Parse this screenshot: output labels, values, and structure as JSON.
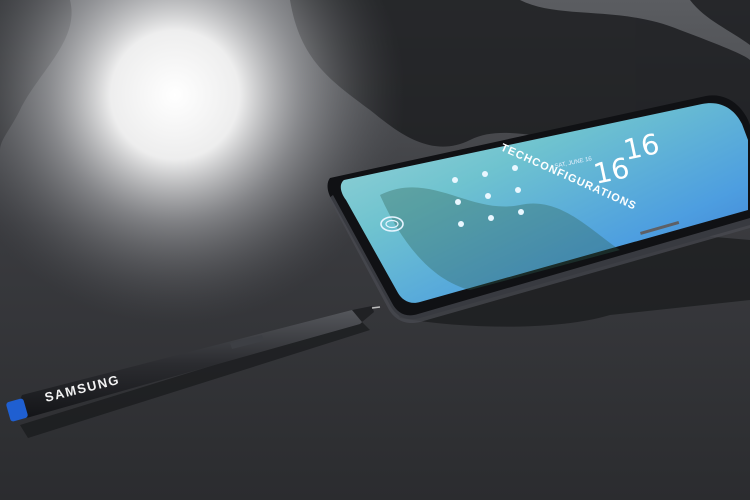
{
  "phone": {
    "clock_hour": "16",
    "clock_minute": "16",
    "lock_date": "SAT, JUNE 16",
    "watermark": "TECHCONFIGURATIONS"
  },
  "pen": {
    "brand": "SAMSUNG",
    "tip_color": "#1f5fd1"
  },
  "colors": {
    "table_dark": "#1e1f22",
    "table_light": "#8a8c90",
    "screen_top": "#4a8fe0",
    "screen_bottom": "#7ecfc8"
  }
}
